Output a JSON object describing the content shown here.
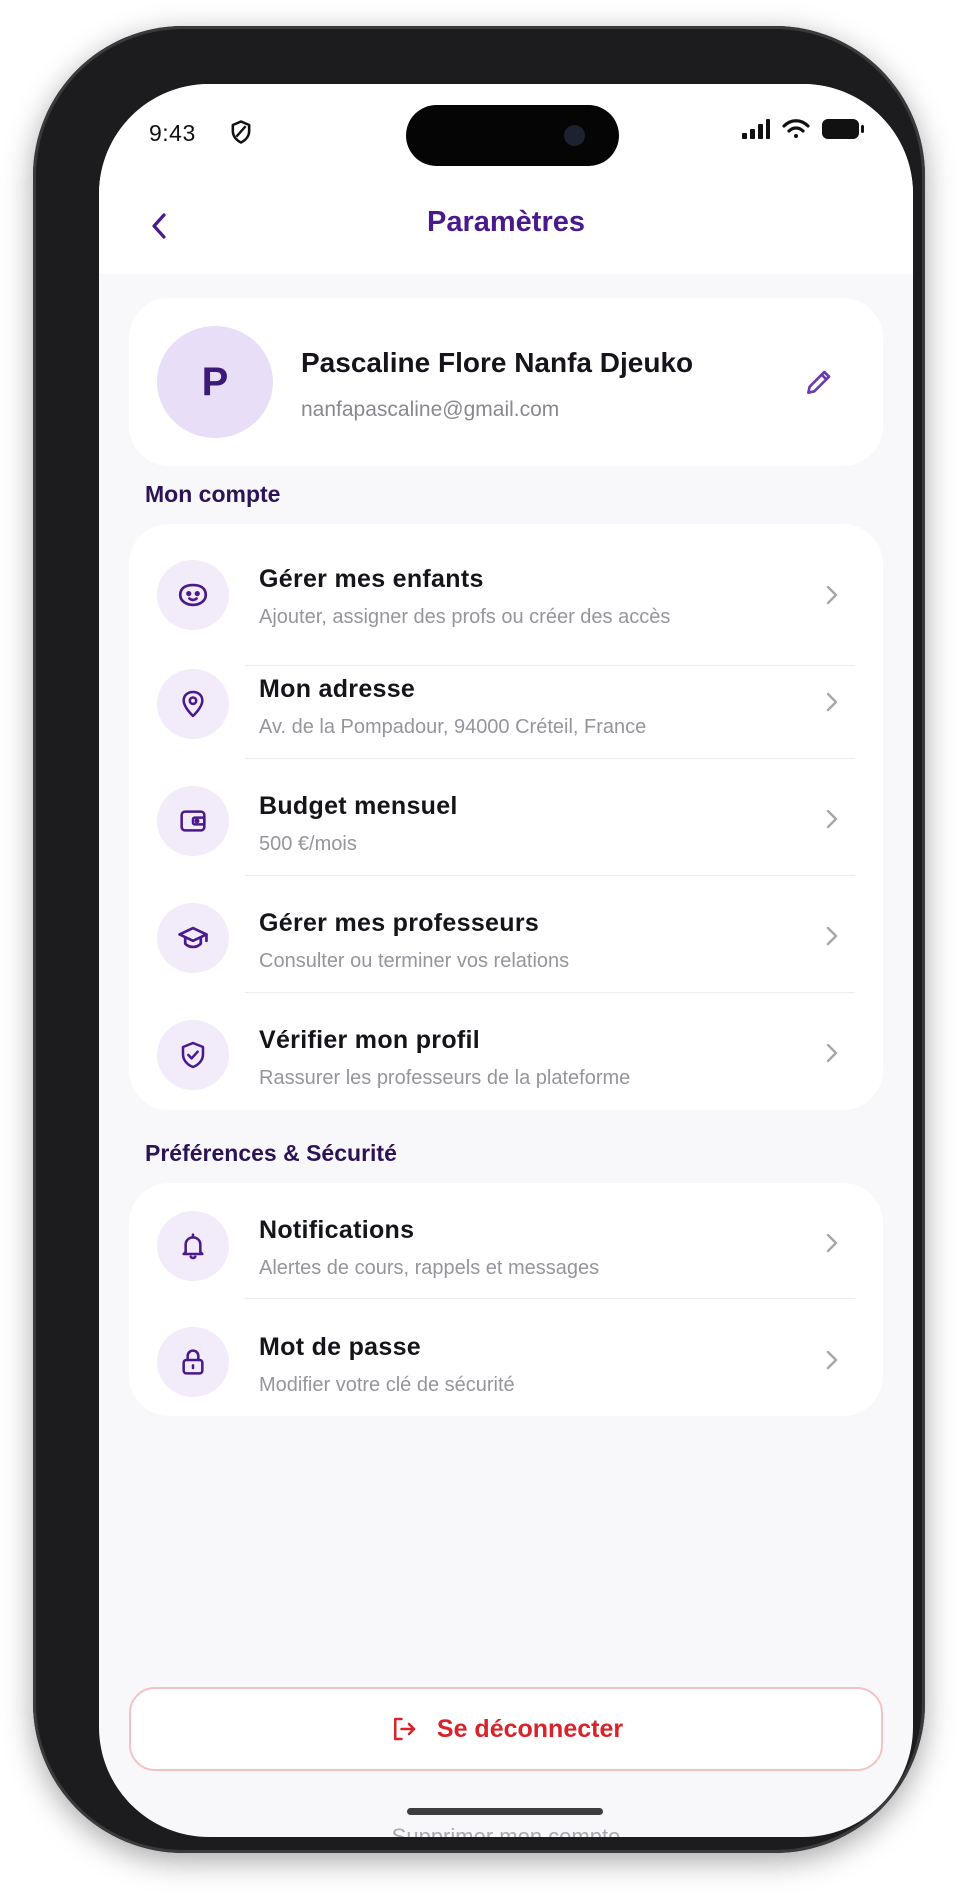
{
  "status_bar": {
    "time": "9:43"
  },
  "header": {
    "title": "Paramètres"
  },
  "profile": {
    "initial": "P",
    "name": "Pascaline Flore Nanfa Djeuko",
    "email": "nanfapascaline@gmail.com"
  },
  "sections": {
    "account": {
      "title": "Mon compte",
      "items": [
        {
          "icon": "child-face-icon",
          "title": "Gérer mes enfants",
          "subtitle": "Ajouter, assigner des profs ou créer des accès"
        },
        {
          "icon": "location-pin-icon",
          "title": "Mon adresse",
          "subtitle": "Av. de la Pompadour, 94000 Créteil, France"
        },
        {
          "icon": "wallet-icon",
          "title": "Budget mensuel",
          "subtitle": "500 €/mois"
        },
        {
          "icon": "graduation-cap-icon",
          "title": "Gérer mes professeurs",
          "subtitle": "Consulter ou terminer vos relations"
        },
        {
          "icon": "shield-check-icon",
          "title": "Vérifier mon profil",
          "subtitle": "Rassurer les professeurs de la plateforme"
        }
      ]
    },
    "security": {
      "title": "Préférences & Sécurité",
      "items": [
        {
          "icon": "bell-icon",
          "title": "Notifications",
          "subtitle": "Alertes de cours, rappels et messages"
        },
        {
          "icon": "lock-icon",
          "title": "Mot de passe",
          "subtitle": "Modifier votre clé de sécurité"
        }
      ]
    }
  },
  "logout": {
    "label": "Se déconnecter"
  },
  "footer": {
    "delete_account": "Supprimer mon compte"
  },
  "colors": {
    "accent": "#4a1a8c",
    "icon_bg": "#f2ebf9",
    "danger": "#d8232a"
  }
}
